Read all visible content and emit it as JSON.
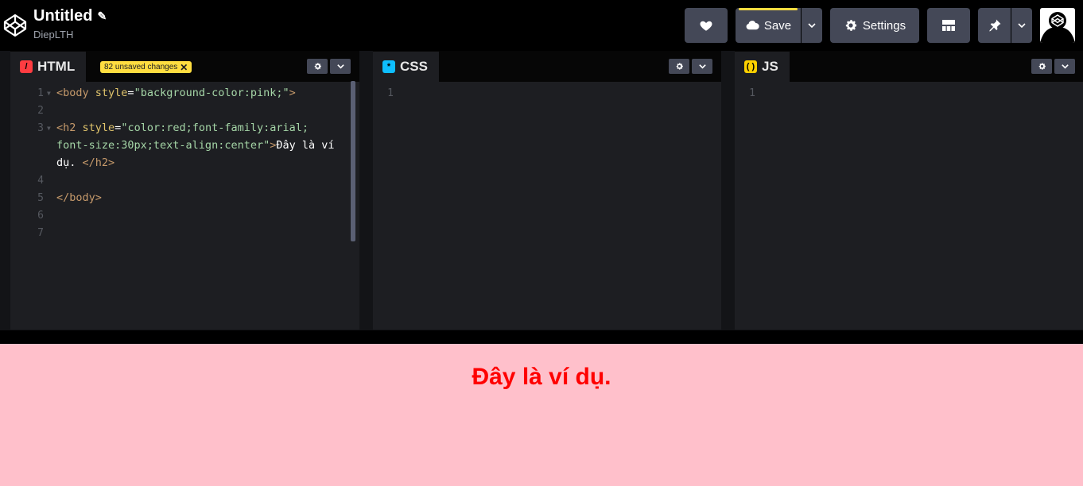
{
  "header": {
    "title": "Untitled",
    "user": "DiepLTH",
    "save_label": "Save",
    "settings_label": "Settings",
    "icons": {
      "logo": "codepen-logo-icon",
      "edit": "pencil-icon",
      "heart": "heart-icon",
      "cloud": "cloud-icon",
      "gear": "gear-icon",
      "layout": "layout-grid-icon",
      "pin": "pin-icon",
      "chevron": "chevron-down-icon",
      "avatar": "avatar-icon"
    },
    "accent_color": "#ffdd40"
  },
  "panes": {
    "html": {
      "label": "HTML",
      "badge": "82 unsaved changes",
      "icon_color": "#ff3c41",
      "line_numbers": [
        "1",
        "2",
        "3",
        "4",
        "5",
        "6",
        "7"
      ],
      "code": {
        "l1_open": "<body",
        "l1_attr": " style",
        "l1_eq": "=",
        "l1_str": "\"background-color:pink;\"",
        "l1_close": ">",
        "l3_open": "<h2",
        "l3_attr": " style",
        "l3_eq": "=",
        "l3_str_a": "\"color:red;font-family:arial;",
        "l3_str_b": "font-size:30px;text-align:center\"",
        "l3_close": ">",
        "l3_text_a": "Đây là ví",
        "l3_text_b": "dụ. ",
        "l3_end": "</h2>",
        "l5_end": "</body>"
      }
    },
    "css": {
      "label": "CSS",
      "icon_color": "#0ebeff",
      "line_numbers": [
        "1"
      ]
    },
    "js": {
      "label": "JS",
      "icon_color": "#fcd000",
      "line_numbers": [
        "1"
      ]
    }
  },
  "preview": {
    "background": "pink",
    "heading": "Đây là ví dụ."
  }
}
